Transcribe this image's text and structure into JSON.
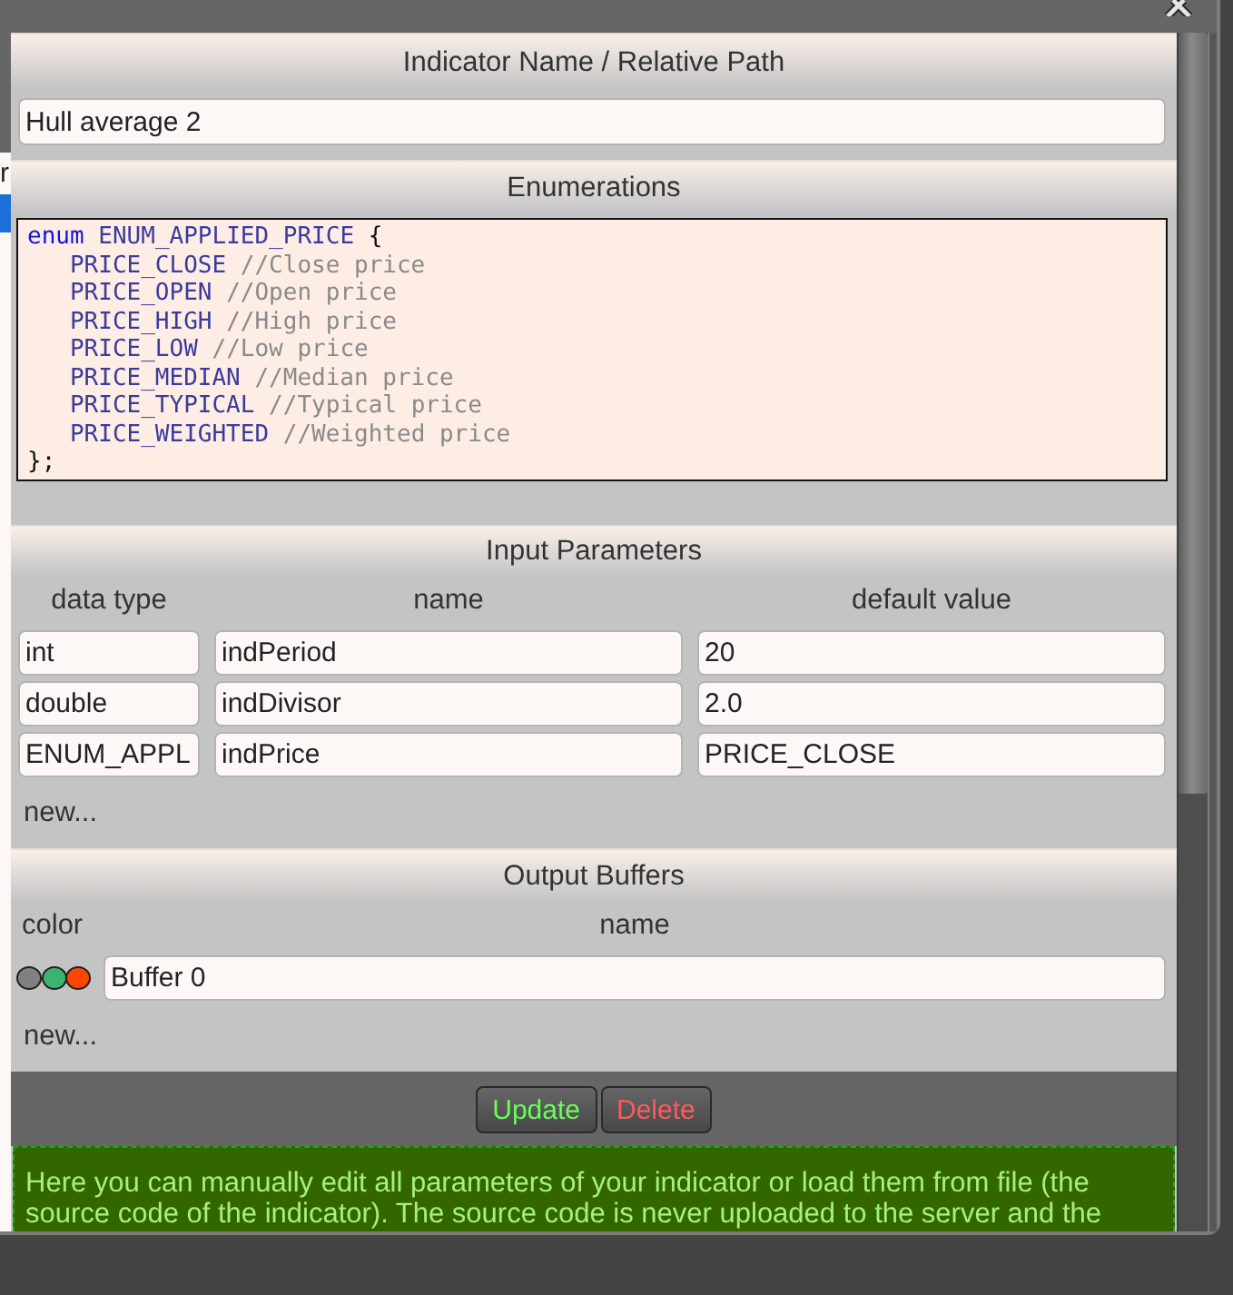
{
  "background": {
    "text": "r"
  },
  "name_section": {
    "title": "Indicator Name / Relative Path",
    "value": "Hull average 2"
  },
  "enumerations": {
    "title": "Enumerations",
    "code": {
      "keyword": "enum",
      "name": "ENUM_APPLIED_PRICE",
      "open": "{",
      "members": [
        {
          "name": "PRICE_CLOSE",
          "comment": "//Close price"
        },
        {
          "name": "PRICE_OPEN",
          "comment": "//Open price"
        },
        {
          "name": "PRICE_HIGH",
          "comment": "//High price"
        },
        {
          "name": "PRICE_LOW",
          "comment": "//Low price"
        },
        {
          "name": "PRICE_MEDIAN",
          "comment": "//Median price"
        },
        {
          "name": "PRICE_TYPICAL",
          "comment": "//Typical price"
        },
        {
          "name": "PRICE_WEIGHTED",
          "comment": "//Weighted price"
        }
      ],
      "close": "};"
    }
  },
  "input_parameters": {
    "title": "Input Parameters",
    "columns": [
      "data type",
      "name",
      "default value"
    ],
    "rows": [
      [
        "int",
        "indPeriod",
        "20"
      ],
      [
        "double",
        "indDivisor",
        "2.0"
      ],
      [
        "ENUM_APPL",
        "indPrice",
        "PRICE_CLOSE"
      ]
    ],
    "new_link": "new..."
  },
  "output_buffers": {
    "title": "Output Buffers",
    "columns": [
      "color",
      "name"
    ],
    "rows": [
      {
        "swatches": [
          {
            "color": "#808080"
          },
          {
            "color": "#3cb371"
          },
          {
            "color": "#ff4500"
          }
        ],
        "name": "Buffer 0"
      }
    ],
    "new_link": "new..."
  },
  "buttons": [
    {
      "label": "Update",
      "color": "#66ff55"
    },
    {
      "label": "Delete",
      "color": "#ff5a5a"
    }
  ],
  "info": "Here you can manually edit all parameters of your indicator or load them from file (the source code of the indicator). The source code is never uploaded to the server and the"
}
